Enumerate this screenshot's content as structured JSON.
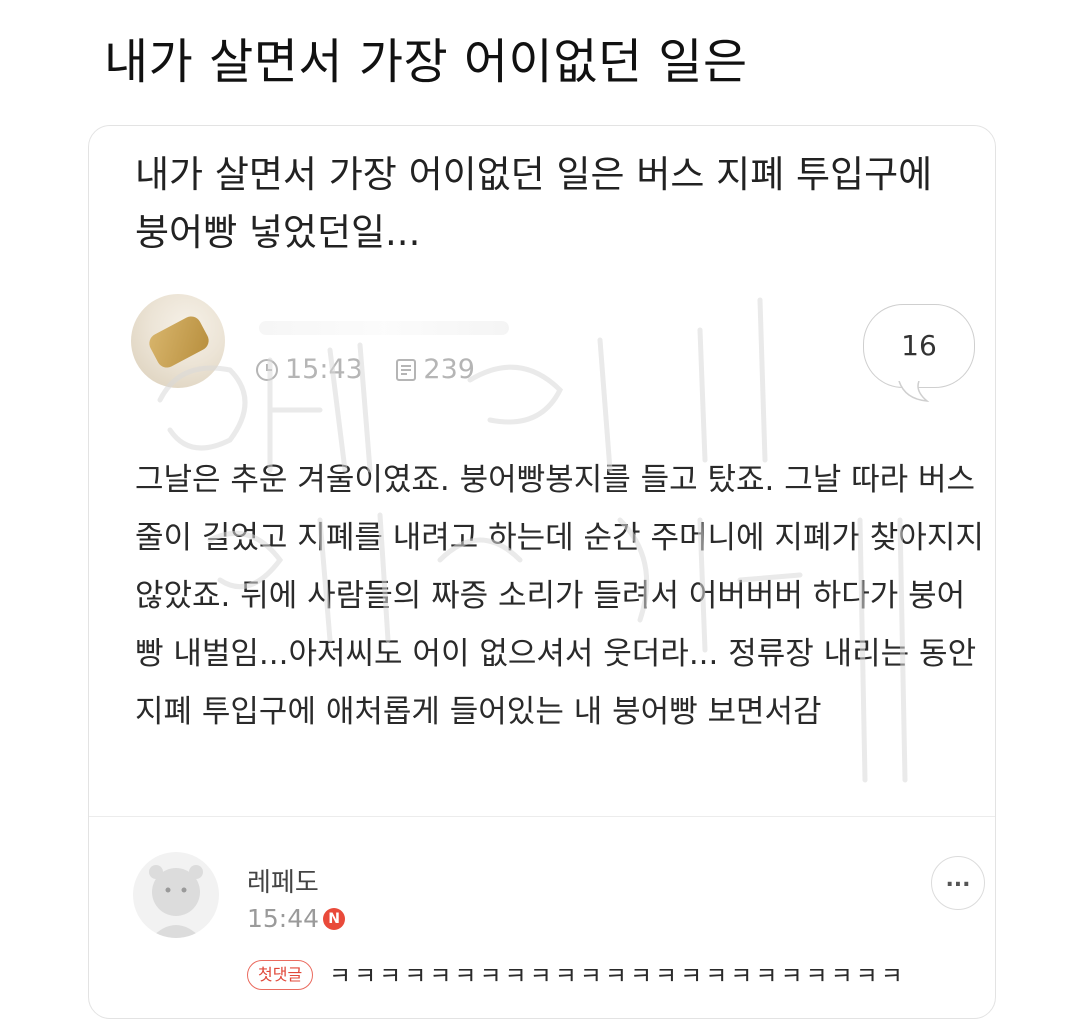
{
  "page": {
    "title": "내가 살면서 가장 어이없던 일은"
  },
  "post": {
    "title": "내가 살면서 가장 어이없던 일은 버스 지폐 투입구에 붕어빵 넣었던일...",
    "time": "15:43",
    "views": "239",
    "comment_count": "16",
    "body": "그날은 추운 겨울이였죠. 붕어빵봉지를 들고 탔죠. 그날 따라 버스 줄이 길었고 지폐를 내려고 하는데 순간 주머니에 지폐가 찾아지지 않았죠. 뒤에 사람들의 짜증 소리가 들려서        어버버버 하다가 붕어빵 내벌임...아저씨도 어이 없으셔서 웃더라... 정류장 내리는 동안 지폐 투입구에 애처롭게 들어있는 내 붕어빵 보면서감"
  },
  "comment": {
    "name": "레페도",
    "time": "15:44",
    "badge": "N",
    "tag": "첫댓글",
    "text": "ㅋㅋㅋㅋㅋㅋㅋㅋㅋㅋㅋㅋㅋㅋㅋㅋㅋㅋㅋㅋㅋㅋㅋ",
    "more": "..."
  },
  "icons": {
    "clock": "clock-icon",
    "views": "document-icon",
    "more": "more-icon"
  },
  "colors": {
    "badge": "#e94a3a",
    "tag": "#e0483a",
    "meta": "#b5b5b5"
  }
}
